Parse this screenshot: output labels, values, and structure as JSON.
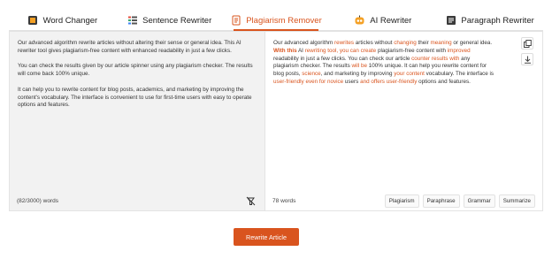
{
  "tabs": [
    {
      "label": "Word Changer",
      "icon": "book-icon"
    },
    {
      "label": "Sentence Rewriter",
      "icon": "list-icon"
    },
    {
      "label": "Plagiarism Remover",
      "icon": "document-icon",
      "active": true
    },
    {
      "label": "AI Rewriter",
      "icon": "robot-icon"
    },
    {
      "label": "Paragraph Rewriter",
      "icon": "paragraph-icon"
    }
  ],
  "input": {
    "paragraphs": [
      "Our advanced algorithm rewrite articles without altering their sense or general idea. This AI rewriter tool gives plagiarism-free content with enhanced readability in just a few clicks.",
      "You can check the results given by our article spinner using any plagiarism checker. The results will come back 100% unique.",
      "It can help you to rewrite content for blog posts, academics, and marketing by improving the content's vocabulary. The interface is convenient to use for first-time users with easy to operate options and features."
    ],
    "word_count": "(82/3000) words"
  },
  "output": {
    "segments": [
      {
        "t": "Our advanced algorithm ",
        "s": ""
      },
      {
        "t": "rewrites",
        "s": "hl"
      },
      {
        "t": " articles without ",
        "s": ""
      },
      {
        "t": "changing",
        "s": "hl"
      },
      {
        "t": " their ",
        "s": ""
      },
      {
        "t": "meaning",
        "s": "hl"
      },
      {
        "t": " or general idea. ",
        "s": ""
      },
      {
        "t": "With this",
        "s": "hlb"
      },
      {
        "t": " AI ",
        "s": ""
      },
      {
        "t": "rewriting tool, you can create",
        "s": "hl"
      },
      {
        "t": " plagiarism-free content with ",
        "s": ""
      },
      {
        "t": "improved",
        "s": "hl"
      },
      {
        "t": " readability in just a few clicks. You can check our article ",
        "s": ""
      },
      {
        "t": "counter results with",
        "s": "hl"
      },
      {
        "t": " any plagiarism checker. The results ",
        "s": ""
      },
      {
        "t": "will be",
        "s": "hl"
      },
      {
        "t": " 100% unique. It can help you rewrite content for blog posts, ",
        "s": ""
      },
      {
        "t": "science",
        "s": "hl"
      },
      {
        "t": ", and marketing by improving ",
        "s": ""
      },
      {
        "t": "your content",
        "s": "hl"
      },
      {
        "t": " vocabulary. The interface is ",
        "s": ""
      },
      {
        "t": "user-friendly even for",
        "s": "hl"
      },
      {
        "t": " ",
        "s": ""
      },
      {
        "t": "novice",
        "s": "hl"
      },
      {
        "t": " users ",
        "s": ""
      },
      {
        "t": "and offers user-friendly",
        "s": "hl"
      },
      {
        "t": " options and features.",
        "s": ""
      }
    ],
    "word_count": "78 words",
    "actions": [
      "Plagiarism",
      "Paraphrase",
      "Grammar",
      "Summarize"
    ]
  },
  "icons": {
    "copy": "copy-icon",
    "download": "download-icon",
    "clear": "eraser-icon"
  },
  "rewrite_button": "Rewrite Article",
  "colors": {
    "accent": "#d9541e",
    "input_bg": "#f2f2f2"
  }
}
